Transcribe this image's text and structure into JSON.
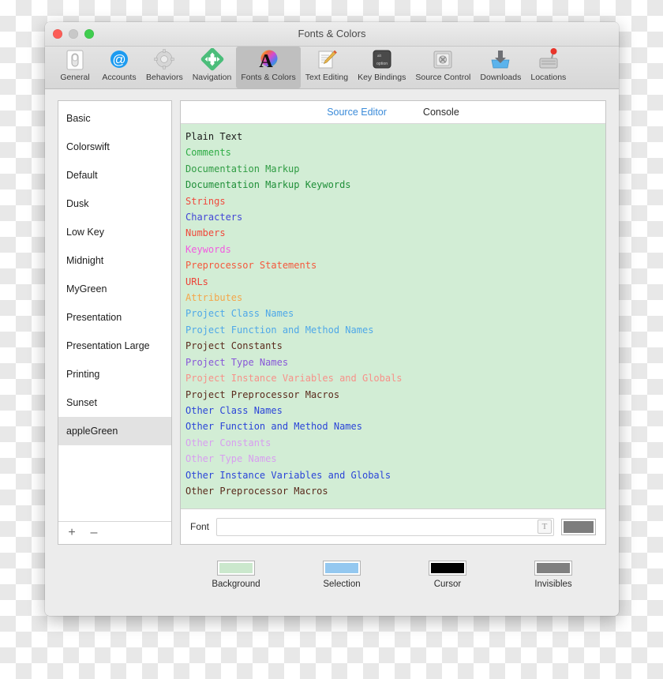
{
  "window": {
    "title": "Fonts & Colors",
    "traffic_lights": [
      "close",
      "minimize",
      "zoom"
    ]
  },
  "toolbar": {
    "items": [
      {
        "label": "General",
        "icon": "light-switch-icon",
        "selected": false
      },
      {
        "label": "Accounts",
        "icon": "at-sign-icon",
        "selected": false
      },
      {
        "label": "Behaviors",
        "icon": "gear-icon",
        "selected": false
      },
      {
        "label": "Navigation",
        "icon": "move-arrows-icon",
        "selected": false
      },
      {
        "label": "Fonts & Colors",
        "icon": "color-letter-a-icon",
        "selected": true
      },
      {
        "label": "Text Editing",
        "icon": "page-pencil-icon",
        "selected": false
      },
      {
        "label": "Key Bindings",
        "icon": "option-key-icon",
        "selected": false
      },
      {
        "label": "Source Control",
        "icon": "safe-vault-icon",
        "selected": false
      },
      {
        "label": "Downloads",
        "icon": "download-tray-icon",
        "selected": false
      },
      {
        "label": "Locations",
        "icon": "joystick-disk-icon",
        "selected": false
      }
    ]
  },
  "sidebar": {
    "themes": [
      {
        "name": "Basic",
        "selected": false
      },
      {
        "name": "Colorswift",
        "selected": false
      },
      {
        "name": "Default",
        "selected": false
      },
      {
        "name": "Dusk",
        "selected": false
      },
      {
        "name": "Low Key",
        "selected": false
      },
      {
        "name": "Midnight",
        "selected": false
      },
      {
        "name": "MyGreen",
        "selected": false
      },
      {
        "name": "Presentation",
        "selected": false
      },
      {
        "name": "Presentation Large",
        "selected": false
      },
      {
        "name": "Printing",
        "selected": false
      },
      {
        "name": "Sunset",
        "selected": false
      },
      {
        "name": "appleGreen",
        "selected": true
      }
    ],
    "add_button": "+",
    "remove_button": "–"
  },
  "main": {
    "tabs": [
      {
        "label": "Source Editor",
        "active": true
      },
      {
        "label": "Console",
        "active": false
      }
    ],
    "preview_background": "#d2edd5",
    "syntax_items": [
      {
        "label": "Plain Text",
        "color": "#1a1a1a"
      },
      {
        "label": "Comments",
        "color": "#2eac45"
      },
      {
        "label": "Documentation Markup",
        "color": "#2f9c43"
      },
      {
        "label": "Documentation Markup Keywords",
        "color": "#1f8f38"
      },
      {
        "label": "Strings",
        "color": "#f04a3e"
      },
      {
        "label": "Characters",
        "color": "#4346d6"
      },
      {
        "label": "Numbers",
        "color": "#f0473a"
      },
      {
        "label": "Keywords",
        "color": "#f25ce0"
      },
      {
        "label": "Preprocessor Statements",
        "color": "#f4583c"
      },
      {
        "label": "URLs",
        "color": "#ed4238"
      },
      {
        "label": "Attributes",
        "color": "#f4a64a"
      },
      {
        "label": "Project Class Names",
        "color": "#4fa8e8"
      },
      {
        "label": "Project Function and Method Names",
        "color": "#4fa8e8"
      },
      {
        "label": "Project Constants",
        "color": "#5a2a1c"
      },
      {
        "label": "Project Type Names",
        "color": "#8856d8"
      },
      {
        "label": "Project Instance Variables and Globals",
        "color": "#f79189"
      },
      {
        "label": "Project Preprocessor Macros",
        "color": "#5a2a1c"
      },
      {
        "label": "Other Class Names",
        "color": "#2b45d8"
      },
      {
        "label": "Other Function and Method Names",
        "color": "#2b45d8"
      },
      {
        "label": "Other Constants",
        "color": "#d89ef0"
      },
      {
        "label": "Other Type Names",
        "color": "#d89ef0"
      },
      {
        "label": "Other Instance Variables and Globals",
        "color": "#2b45d8"
      },
      {
        "label": "Other Preprocessor Macros",
        "color": "#5a2a1c"
      }
    ],
    "font_row": {
      "label": "Font",
      "value": "",
      "placeholder": "",
      "picker_glyph": "T",
      "color": "#7d7d7d"
    },
    "swatches": [
      {
        "label": "Background",
        "color": "#cbe8cd"
      },
      {
        "label": "Selection",
        "color": "#94c8f0"
      },
      {
        "label": "Cursor",
        "color": "#000000"
      },
      {
        "label": "Invisibles",
        "color": "#808080"
      }
    ]
  }
}
